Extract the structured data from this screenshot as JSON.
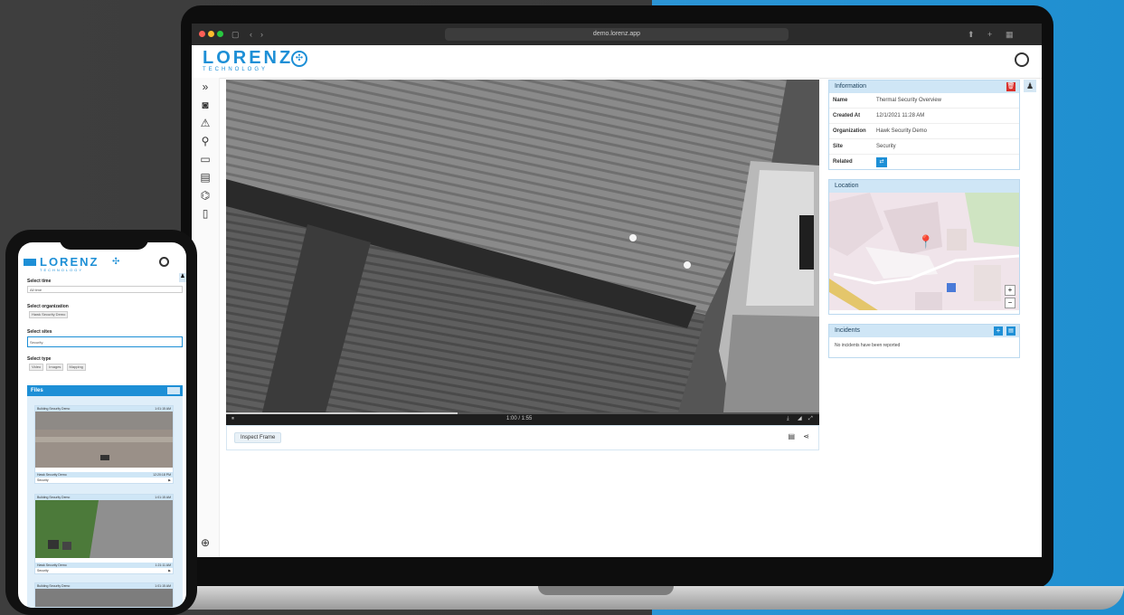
{
  "browser": {
    "url": "demo.lorenz.app"
  },
  "app": {
    "logo_text": "LORENZ",
    "logo_sub": "TECHNOLOGY"
  },
  "sidebar": {
    "items": [
      {
        "icon": "expand-icon",
        "glyph": "»"
      },
      {
        "icon": "camera-icon",
        "glyph": "◙"
      },
      {
        "icon": "warning-icon",
        "glyph": "⚠"
      },
      {
        "icon": "location-pin-icon",
        "glyph": "⚲"
      },
      {
        "icon": "folder-icon",
        "glyph": "▭"
      },
      {
        "icon": "document-icon",
        "glyph": "▤"
      },
      {
        "icon": "hierarchy-icon",
        "glyph": "⌬"
      },
      {
        "icon": "phone-icon",
        "glyph": "▯"
      }
    ],
    "bottom_icon": {
      "icon": "globe-icon",
      "glyph": "⊕"
    }
  },
  "video": {
    "time": "1:00 / 1:55",
    "progress": 0.39
  },
  "actions": {
    "inspect_button": "Inspect Frame"
  },
  "information": {
    "title": "Information",
    "rows": [
      {
        "key": "Name",
        "value": "Thermal Security Overview"
      },
      {
        "key": "Created At",
        "value": "12/1/2021 11:28 AM"
      },
      {
        "key": "Organization",
        "value": "Hawk Security Demo"
      },
      {
        "key": "Site",
        "value": "Security"
      },
      {
        "key": "Related",
        "value": ""
      }
    ]
  },
  "location": {
    "title": "Location",
    "zoom_in": "+",
    "zoom_out": "−"
  },
  "incidents": {
    "title": "Incidents",
    "empty_text": "No incidents have been reported"
  },
  "phone": {
    "fields": [
      {
        "label": "Select time",
        "value": "All time"
      },
      {
        "label": "Select organization",
        "value": "Hawk Security Demo"
      },
      {
        "label": "Select sites",
        "value": "Security"
      },
      {
        "label": "Select type",
        "value": ""
      }
    ],
    "type_chips": [
      "Video",
      "Images",
      "Mapping"
    ],
    "files_title": "Files",
    "cards": [
      {
        "head": "Building Security Demo",
        "head_time": "1:01:15 AM",
        "title": "Hawk Security Demo",
        "time": "12:20:18 PM",
        "site": "Security"
      },
      {
        "head": "Building Security Demo",
        "head_time": "1:01:15 AM",
        "title": "Hawk Security Demo",
        "time": "1:21:11 AM",
        "site": "Security"
      },
      {
        "head": "Building Security Demo",
        "head_time": "1:01:15 AM"
      }
    ]
  },
  "colors": {
    "brand": "#1d8fd6",
    "panel_head": "#cfe6f6",
    "delete": "#d9302b"
  }
}
